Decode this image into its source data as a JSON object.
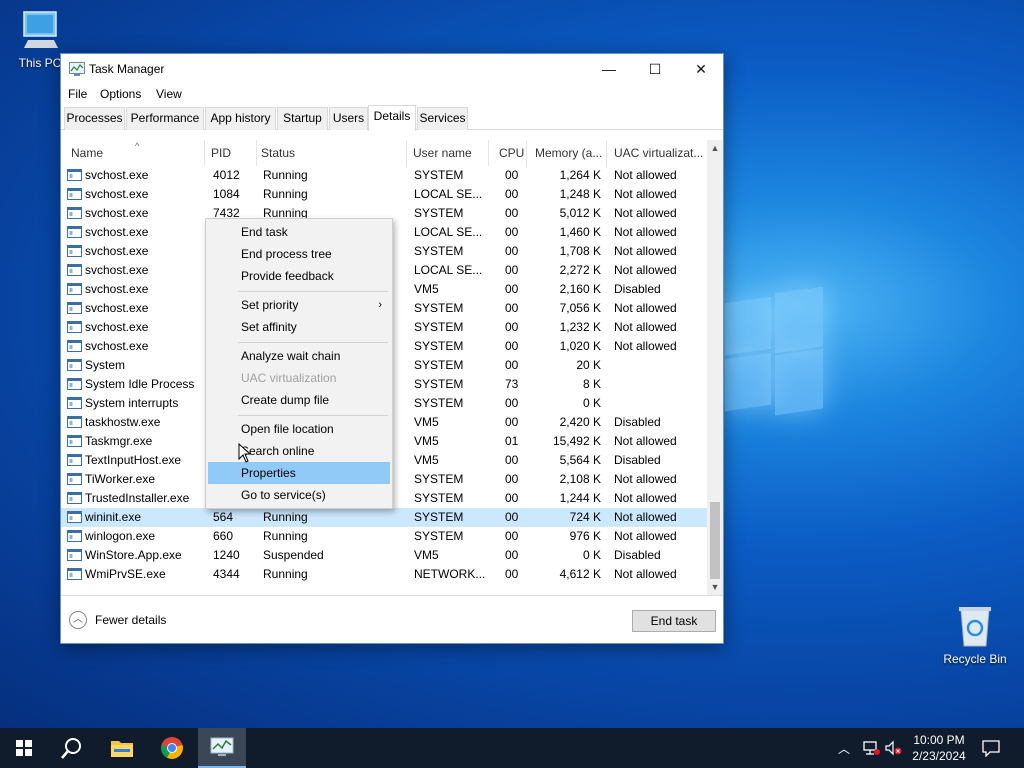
{
  "desktop": {
    "icons": [
      {
        "label": "This PC"
      },
      {
        "label": "Recycle Bin"
      }
    ]
  },
  "window": {
    "title": "Task Manager",
    "minimize": "—",
    "maximize": "☐",
    "close": "✕"
  },
  "menu": [
    "File",
    "Options",
    "View"
  ],
  "tabs": [
    "Processes",
    "Performance",
    "App history",
    "Startup",
    "Users",
    "Details",
    "Services"
  ],
  "active_tab": "Details",
  "columns": [
    "Name",
    "PID",
    "Status",
    "User name",
    "CPU",
    "Memory (a...",
    "UAC virtualizat..."
  ],
  "rows": [
    {
      "name": "svchost.exe",
      "pid": "4012",
      "status": "Running",
      "user": "SYSTEM",
      "cpu": "00",
      "mem": "1,264 K",
      "uac": "Not allowed"
    },
    {
      "name": "svchost.exe",
      "pid": "1084",
      "status": "Running",
      "user": "LOCAL SE...",
      "cpu": "00",
      "mem": "1,248 K",
      "uac": "Not allowed"
    },
    {
      "name": "svchost.exe",
      "pid": "7432",
      "status": "Running",
      "user": "SYSTEM",
      "cpu": "00",
      "mem": "5,012 K",
      "uac": "Not allowed"
    },
    {
      "name": "svchost.exe",
      "pid": "",
      "status": "",
      "user": "LOCAL SE...",
      "cpu": "00",
      "mem": "1,460 K",
      "uac": "Not allowed"
    },
    {
      "name": "svchost.exe",
      "pid": "",
      "status": "",
      "user": "SYSTEM",
      "cpu": "00",
      "mem": "1,708 K",
      "uac": "Not allowed"
    },
    {
      "name": "svchost.exe",
      "pid": "",
      "status": "",
      "user": "LOCAL SE...",
      "cpu": "00",
      "mem": "2,272 K",
      "uac": "Not allowed"
    },
    {
      "name": "svchost.exe",
      "pid": "",
      "status": "",
      "user": "VM5",
      "cpu": "00",
      "mem": "2,160 K",
      "uac": "Disabled"
    },
    {
      "name": "svchost.exe",
      "pid": "",
      "status": "",
      "user": "SYSTEM",
      "cpu": "00",
      "mem": "7,056 K",
      "uac": "Not allowed"
    },
    {
      "name": "svchost.exe",
      "pid": "",
      "status": "",
      "user": "SYSTEM",
      "cpu": "00",
      "mem": "1,232 K",
      "uac": "Not allowed"
    },
    {
      "name": "svchost.exe",
      "pid": "",
      "status": "",
      "user": "SYSTEM",
      "cpu": "00",
      "mem": "1,020 K",
      "uac": "Not allowed"
    },
    {
      "name": "System",
      "pid": "",
      "status": "",
      "user": "SYSTEM",
      "cpu": "00",
      "mem": "20 K",
      "uac": ""
    },
    {
      "name": "System Idle Process",
      "pid": "",
      "status": "",
      "user": "SYSTEM",
      "cpu": "73",
      "mem": "8 K",
      "uac": ""
    },
    {
      "name": "System interrupts",
      "pid": "",
      "status": "",
      "user": "SYSTEM",
      "cpu": "00",
      "mem": "0 K",
      "uac": ""
    },
    {
      "name": "taskhostw.exe",
      "pid": "",
      "status": "",
      "user": "VM5",
      "cpu": "00",
      "mem": "2,420 K",
      "uac": "Disabled"
    },
    {
      "name": "Taskmgr.exe",
      "pid": "",
      "status": "",
      "user": "VM5",
      "cpu": "01",
      "mem": "15,492 K",
      "uac": "Not allowed"
    },
    {
      "name": "TextInputHost.exe",
      "pid": "",
      "status": "",
      "user": "VM5",
      "cpu": "00",
      "mem": "5,564 K",
      "uac": "Disabled"
    },
    {
      "name": "TiWorker.exe",
      "pid": "",
      "status": "",
      "user": "SYSTEM",
      "cpu": "00",
      "mem": "2,108 K",
      "uac": "Not allowed"
    },
    {
      "name": "TrustedInstaller.exe",
      "pid": "",
      "status": "",
      "user": "SYSTEM",
      "cpu": "00",
      "mem": "1,244 K",
      "uac": "Not allowed"
    },
    {
      "name": "wininit.exe",
      "pid": "564",
      "status": "Running",
      "user": "SYSTEM",
      "cpu": "00",
      "mem": "724 K",
      "uac": "Not allowed"
    },
    {
      "name": "winlogon.exe",
      "pid": "660",
      "status": "Running",
      "user": "SYSTEM",
      "cpu": "00",
      "mem": "976 K",
      "uac": "Not allowed"
    },
    {
      "name": "WinStore.App.exe",
      "pid": "1240",
      "status": "Suspended",
      "user": "VM5",
      "cpu": "00",
      "mem": "0 K",
      "uac": "Disabled"
    },
    {
      "name": "WmiPrvSE.exe",
      "pid": "4344",
      "status": "Running",
      "user": "NETWORK...",
      "cpu": "00",
      "mem": "4,612 K",
      "uac": "Not allowed"
    }
  ],
  "selected_row": "wininit.exe",
  "footer": {
    "fewer_details": "Fewer details",
    "end_task": "End task"
  },
  "context_menu": {
    "items": [
      {
        "label": "End task"
      },
      {
        "label": "End process tree"
      },
      {
        "label": "Provide feedback"
      },
      {
        "label": "Set priority",
        "submenu": "›"
      },
      {
        "label": "Set affinity"
      },
      {
        "label": "Analyze wait chain"
      },
      {
        "label": "UAC virtualization",
        "disabled": true
      },
      {
        "label": "Create dump file"
      },
      {
        "label": "Open file location"
      },
      {
        "label": "Search online"
      },
      {
        "label": "Properties",
        "highlighted": true
      },
      {
        "label": "Go to service(s)"
      }
    ]
  },
  "taskbar": {
    "clock_time": "10:00 PM",
    "clock_date": "2/23/2024"
  },
  "colors": {
    "selection": "#cce8ff",
    "menu_highlight": "#91c9f7",
    "taskbar": "#101c2c"
  }
}
